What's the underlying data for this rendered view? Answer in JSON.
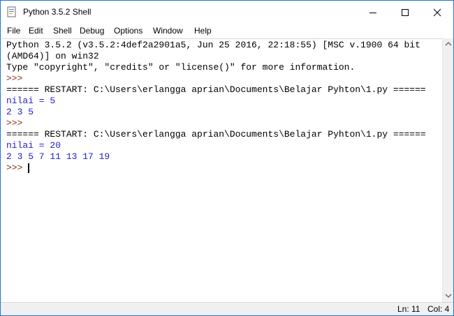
{
  "window": {
    "title": "Python 3.5.2 Shell",
    "controls": {
      "minimize_icon": "minimize-icon",
      "maximize_icon": "maximize-icon",
      "close_icon": "close-icon"
    }
  },
  "menu": {
    "items": [
      "File",
      "Edit",
      "Shell",
      "Debug",
      "Options",
      "Window",
      "Help"
    ]
  },
  "shell": {
    "lines": [
      {
        "text": "Python 3.5.2 (v3.5.2:4def2a2901a5, Jun 25 2016, 22:18:55) [MSC v.1900 64 bit",
        "style": "black"
      },
      {
        "text": "(AMD64)] on win32",
        "style": "black"
      },
      {
        "text": "Type \"copyright\", \"credits\" or \"license()\" for more information.",
        "style": "black"
      },
      {
        "text": ">>>",
        "style": "prompt"
      },
      {
        "text": "====== RESTART: C:\\Users\\erlangga aprian\\Documents\\Belajar Pyhton\\1.py ======",
        "style": "black"
      },
      {
        "text": "nilai = 5",
        "style": "blue"
      },
      {
        "text": "2 3 5",
        "style": "blue"
      },
      {
        "text": ">>>",
        "style": "prompt"
      },
      {
        "text": "====== RESTART: C:\\Users\\erlangga aprian\\Documents\\Belajar Pyhton\\1.py ======",
        "style": "black"
      },
      {
        "text": "nilai = 20",
        "style": "blue"
      },
      {
        "text": "2 3 5 7 11 13 17 19",
        "style": "blue"
      },
      {
        "text": ">>>",
        "style": "prompt"
      }
    ]
  },
  "status": {
    "line": "Ln: 11",
    "col": "Col: 4"
  },
  "colors": {
    "prompt": "#8b2c1a",
    "output_blue": "#1f1fbf",
    "window_border": "#1b74d8"
  }
}
